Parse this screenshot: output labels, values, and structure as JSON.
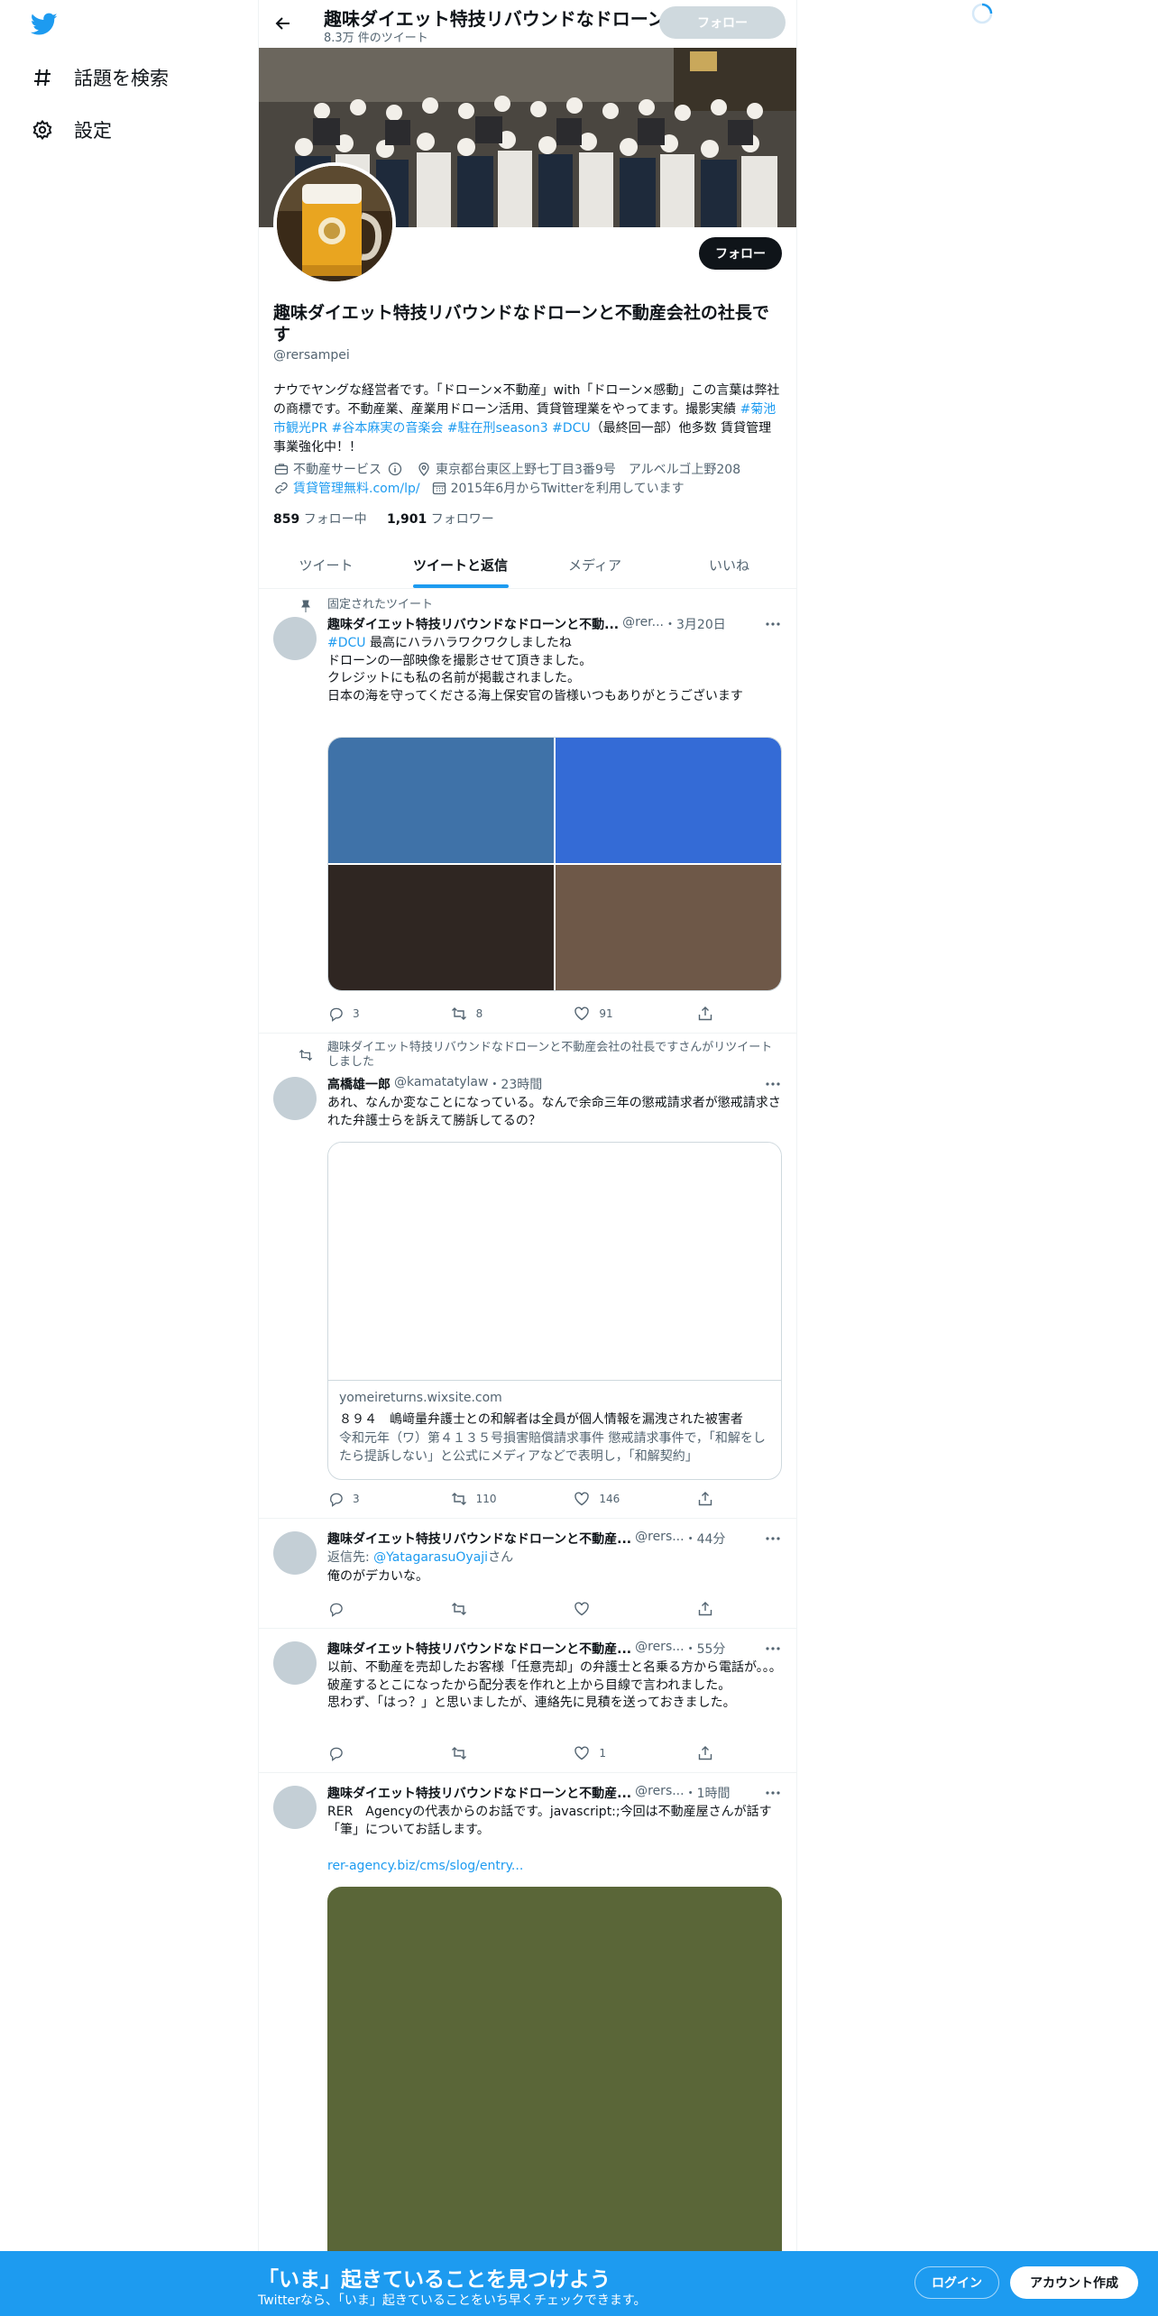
{
  "nav": {
    "explore_label": "話題を検索",
    "settings_label": "設定"
  },
  "header": {
    "title": "趣味ダイエット特技リバウンドなドローンと不動産会社の社長です",
    "tweet_count": "8.3万 件のツイート",
    "follow_label": "フォロー"
  },
  "profile": {
    "name": "趣味ダイエット特技リバウンドなドローンと不動産会社の社長です",
    "handle": "@rersampei",
    "follow_label": "フォロー",
    "bio_1": "ナウでヤングな経営者です。「ドローン×不動産」with「ドローン×感動」この言葉は弊社の商標です。不動産業、産業用ドローン活用、賃貸管理業をやってます。撮影実績 ",
    "bio_tag1": "#菊池市観光PR",
    "bio_tag2": "#谷本麻実の音楽会",
    "bio_tag3": "#駐在刑season3",
    "bio_tag4": "#DCU",
    "bio_2": "（最終回一部）他多数 賃貸管理事業強化中！！",
    "category": "不動産サービス",
    "location": "東京都台東区上野七丁目3番9号　アルベルゴ上野208",
    "website": "賃貸管理無料.com/lp/",
    "joined": "2015年6月からTwitterを利用しています",
    "following_count": "859",
    "following_label": "フォロー中",
    "followers_count": "1,901",
    "followers_label": "フォロワー"
  },
  "tabs": [
    "ツイート",
    "ツイートと返信",
    "メディア",
    "いいね"
  ],
  "tweets": [
    {
      "context": "固定されたツイート",
      "name": "趣味ダイエット特技リバウンドなドローンと不動...",
      "handle": "@rer...",
      "time": "・3月20日",
      "tag": "#DCU",
      "text_1": " 最高にハラハラワクワクしましたね",
      "text_2": "ドローンの一部映像を撮影させて頂きました。",
      "text_3": "クレジットにも私の名前が掲載されました。",
      "text_4": "日本の海を守ってくださる海上保安官の皆様いつもありがとうございます",
      "images": [
        "#3f72a8",
        "#346bd6",
        "#2f2622",
        "#6e5848"
      ],
      "reply": "3",
      "retweet": "8",
      "like": "91"
    },
    {
      "context": "趣味ダイエット特技リバウンドなドローンと不動産会社の社長ですさんがリツイートしました",
      "name": "高橋雄一郎",
      "handle": "@kamatatylaw",
      "time": "・23時間",
      "text": "あれ、なんか変なことになっている。なんで余命三年の懲戒請求者が懲戒請求された弁護士らを訴えて勝訴してるの？",
      "card_domain": "yomeireturns.wixsite.com",
      "card_title": "８９４　嶋﨑量弁護士との和解者は全員が個人情報を漏洩された被害者",
      "card_desc": "令和元年（ワ）第４１３５号損害賠償請求事件 懲戒請求事件で，「和解をしたら提訴しない」と公式にメディアなどで表明し，「和解契約」",
      "reply": "3",
      "retweet": "110",
      "like": "146"
    },
    {
      "name": "趣味ダイエット特技リバウンドなドローンと不動産...",
      "handle": "@rers...",
      "time": "・44分",
      "reply_prefix": "返信先: ",
      "reply_to": "@YatagarasuOyaji",
      "reply_suffix": "さん",
      "text": "俺のがデカいな。"
    },
    {
      "name": "趣味ダイエット特技リバウンドなドローンと不動産...",
      "handle": "@rers...",
      "time": "・55分",
      "text_1": "以前、不動産を売却したお客様「任意売却」の弁護士と名乗る方から電話が。。。",
      "text_2": "破産するとこになったから配分表を作れと上から目線で言われました。",
      "text_3": "思わず、「はっ？」と思いましたが、連絡先に見積を送っておきました。",
      "like": "1"
    },
    {
      "name": "趣味ダイエット特技リバウンドなドローンと不動産...",
      "handle": "@rers...",
      "time": "・1時間",
      "text": "RER　Agencyの代表からのお話です。javascript:;今回は不動産屋さんが話す「筆」についてお話します。",
      "link": "rer-agency.biz/cms/slog/entry...",
      "image_color": "#5a6638"
    }
  ],
  "bottom": {
    "title": "「いま」起きていることを見つけよう",
    "subtitle": "Twitterなら、「いま」起きていることをいち早くチェックできます。",
    "login": "ログイン",
    "signup": "アカウント作成"
  },
  "colors": {
    "accent": "#1d9bf0",
    "text": "#0f1419",
    "secondary": "#536471"
  }
}
